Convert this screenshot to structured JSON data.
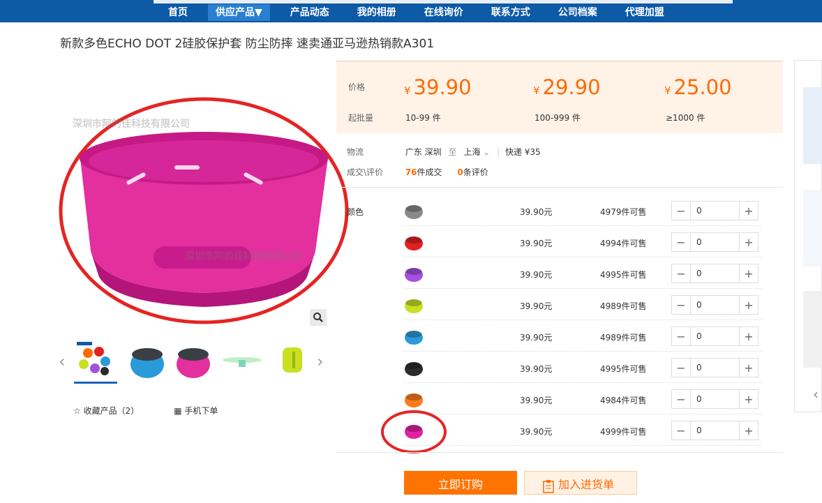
{
  "nav": {
    "items": [
      "首页",
      "供应产品▼",
      "产品动态",
      "我的相册",
      "在线询价",
      "联系方式",
      "公司档案",
      "代理加盟"
    ]
  },
  "product": {
    "title": "新款多色ECHO DOT 2硅胶保护套 防尘防摔 速卖通亚马逊热销款A301",
    "watermark": "深圳市阿的佳科技有限公司"
  },
  "pricing": {
    "price_label": "价格",
    "qty_label": "起批量",
    "currency": "¥",
    "tiers": [
      {
        "price": "39.90",
        "qty": "10-99 件"
      },
      {
        "price": "29.90",
        "qty": "100-999 件"
      },
      {
        "price": "25.00",
        "qty": "≥1000 件"
      }
    ]
  },
  "logistics": {
    "label": "物流",
    "from": "广东 深圳",
    "to_word": "至",
    "to": "上海",
    "express": "快递 ¥35",
    "deal_label": "成交\\评价",
    "deals": "76",
    "deals_unit": "件成交",
    "reviews": "0",
    "reviews_unit": "条评价"
  },
  "variants": {
    "label": "颜色",
    "rows": [
      {
        "color": "#8a8a8a",
        "price": "39.90元",
        "stock": "4979件可售",
        "qty": "0"
      },
      {
        "color": "#e32020",
        "price": "39.90元",
        "stock": "4994件可售",
        "qty": "0"
      },
      {
        "color": "#a550e0",
        "price": "39.90元",
        "stock": "4995件可售",
        "qty": "0"
      },
      {
        "color": "#c9e022",
        "price": "39.90元",
        "stock": "4989件可售",
        "qty": "0"
      },
      {
        "color": "#2a9ad8",
        "price": "39.90元",
        "stock": "4989件可售",
        "qty": "0"
      },
      {
        "color": "#2b2b2b",
        "price": "39.90元",
        "stock": "4995件可售",
        "qty": "0"
      },
      {
        "color": "#ff7a1a",
        "price": "39.90元",
        "stock": "4984件可售",
        "qty": "0"
      },
      {
        "color": "#e020a0",
        "price": "39.90元",
        "stock": "4999件可售",
        "qty": "0"
      }
    ]
  },
  "actions": {
    "favorite": "收藏产品（2）",
    "mobile": "手机下单",
    "buy": "立即订购",
    "cart": "加入进货单"
  },
  "colors": {
    "brand_blue": "#0d5aa7",
    "price_orange": "#ff6a00",
    "product_pink": "#e3309e",
    "annotation_red": "#e52424"
  }
}
